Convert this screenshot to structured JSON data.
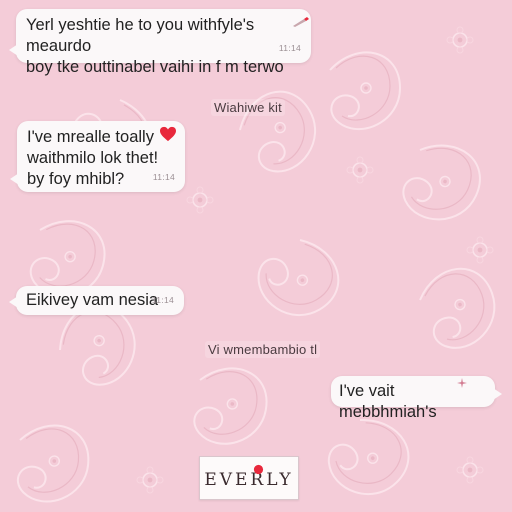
{
  "chat": {
    "messages": [
      {
        "direction": "incoming",
        "text": "Yerl yeshtie he to you withfyle's meaurdo\nboy tke outtinabel vaihi in  f m terwo",
        "time": "11:14"
      },
      {
        "direction": "incoming",
        "text": "I've mrealle toally\nwaithmilo lok thet!\nby foy mhibl?",
        "time": "11:14"
      },
      {
        "direction": "incoming",
        "text": "Eikivey vam nesia",
        "time": "11:14"
      },
      {
        "direction": "outgoing",
        "text": "I've vait mebbhmiah's",
        "time": ""
      }
    ],
    "system_notes": [
      "Wiahiwe kit",
      "Vi wmembambio tl"
    ]
  },
  "brand": {
    "logo_text": "EVERLY"
  },
  "colors": {
    "background": "#f4ccd8",
    "bubble": "#fbf8f9",
    "heart": "#e8283c",
    "text": "#222222",
    "timestamp": "#9b8f94"
  },
  "icons": {
    "heart": "heart-icon",
    "pen": "pen-icon",
    "sparkle": "sparkle-icon"
  }
}
